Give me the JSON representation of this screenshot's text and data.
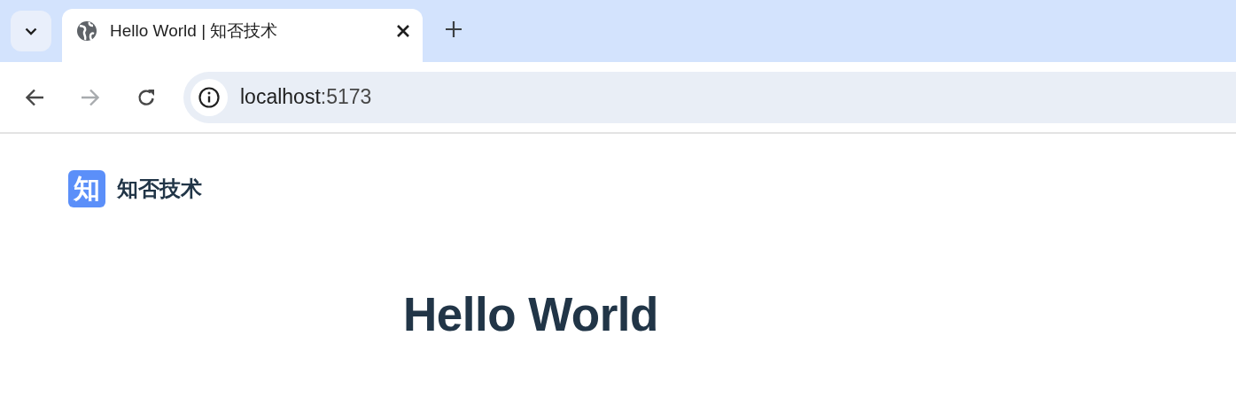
{
  "tabs": [
    {
      "title": "Hello World | 知否技术",
      "selected": true
    }
  ],
  "address_bar": {
    "host": "localhost",
    "port": ":5173"
  },
  "navigation": {
    "back_disabled": false,
    "forward_disabled": true
  },
  "page": {
    "logo_mark": "知",
    "site_name": "知否技术",
    "heading": "Hello World"
  }
}
